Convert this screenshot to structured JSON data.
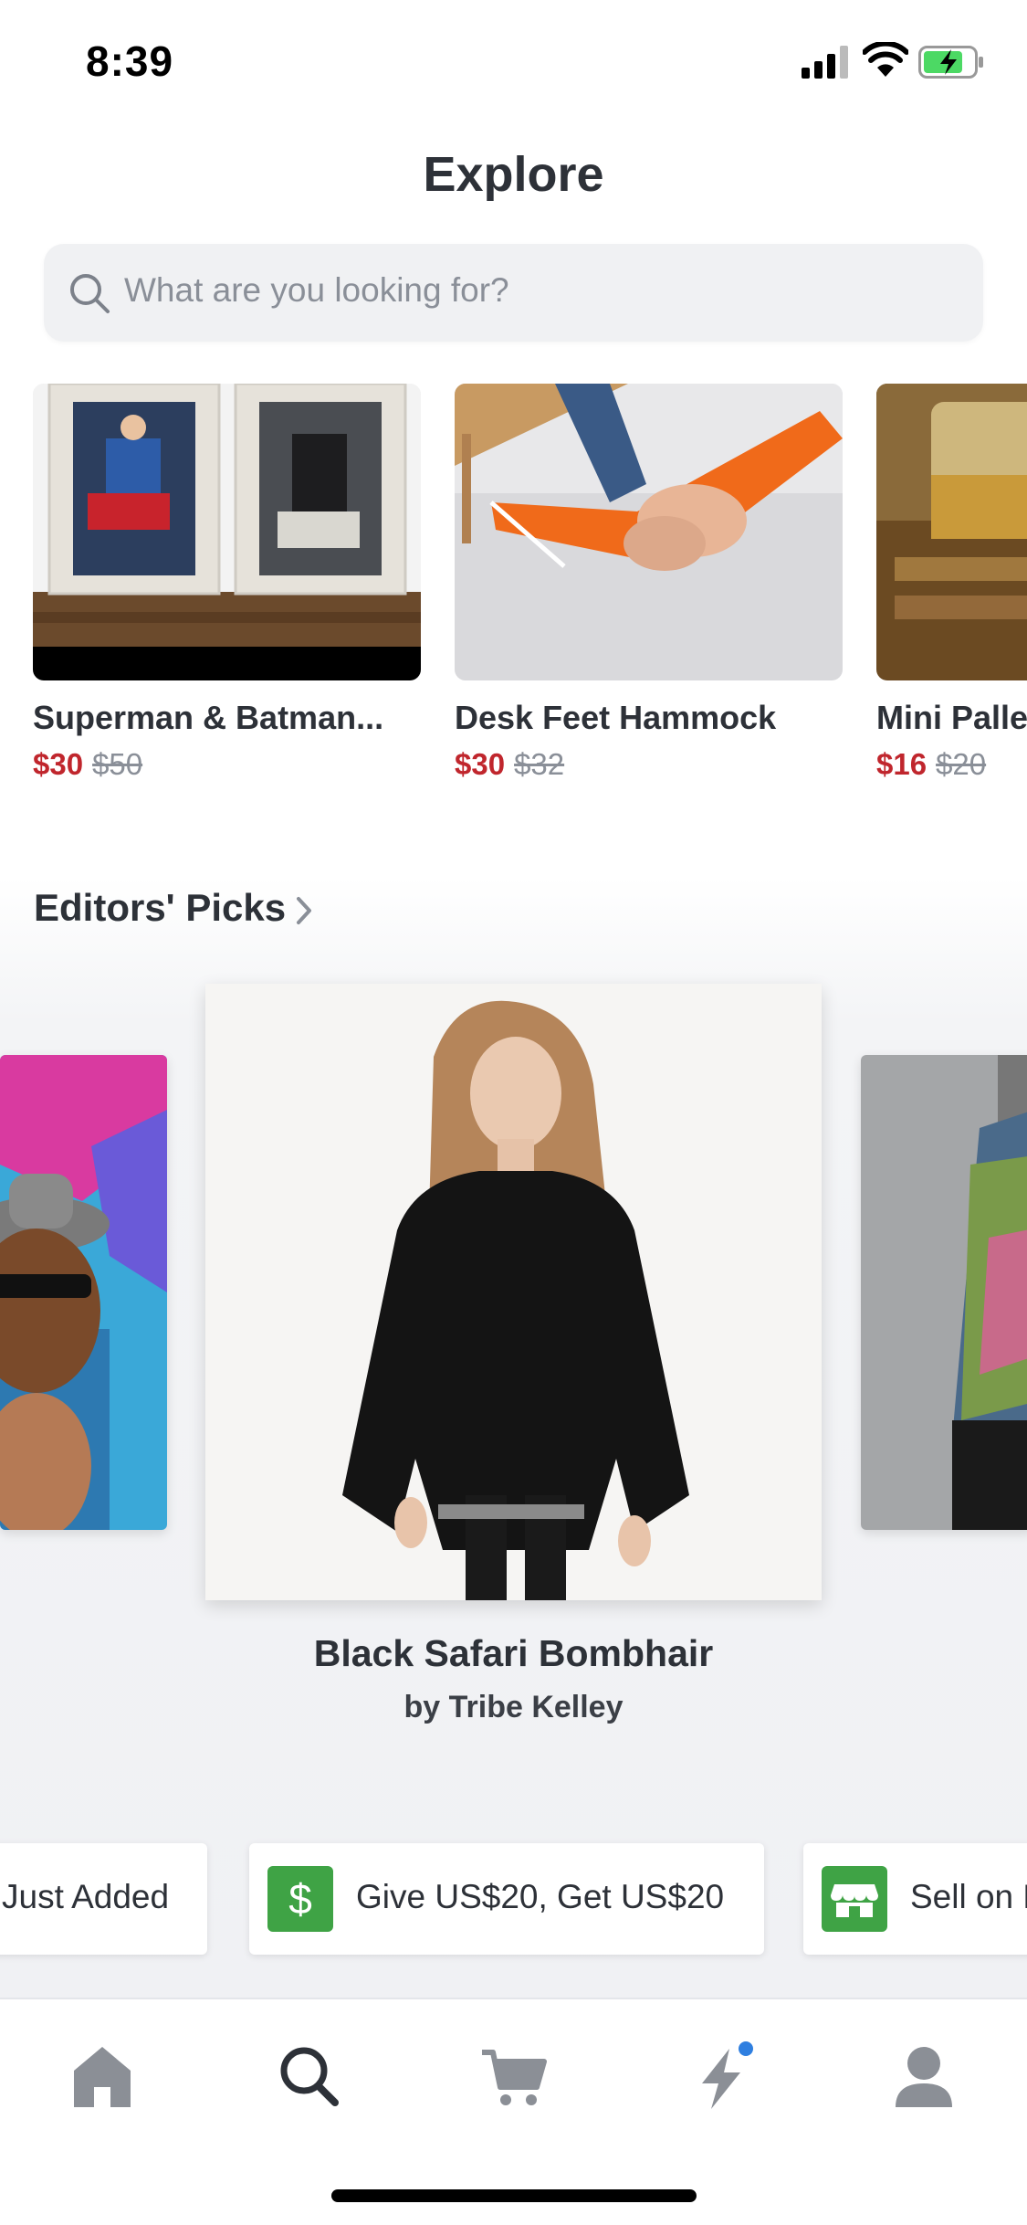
{
  "status_bar": {
    "time": "8:39"
  },
  "header": {
    "title": "Explore"
  },
  "search": {
    "placeholder": "What are you looking for?"
  },
  "products": [
    {
      "name": "Superman & Batman...",
      "price": "$30",
      "old_price": "$50"
    },
    {
      "name": "Desk Feet Hammock",
      "price": "$30",
      "old_price": "$32"
    },
    {
      "name": "Mini Pallet",
      "price": "$16",
      "old_price": "$20"
    }
  ],
  "editors_picks": {
    "title": "Editors' Picks",
    "featured": {
      "name": "Black Safari Bombhair",
      "by": "by Tribe Kelley"
    }
  },
  "promos": [
    {
      "label": "Just Added"
    },
    {
      "label": "Give US$20, Get US$20",
      "icon": "dollar-icon"
    },
    {
      "label": "Sell on Etsy",
      "icon": "shop-icon"
    }
  ],
  "tabs": [
    {
      "icon": "home-icon"
    },
    {
      "icon": "search-icon"
    },
    {
      "icon": "cart-icon"
    },
    {
      "icon": "bolt-icon"
    },
    {
      "icon": "profile-icon"
    }
  ],
  "colors": {
    "sale": "#c0262d",
    "accent": "#3fa345",
    "badge": "#2f7fe0",
    "text": "#2d3138"
  }
}
